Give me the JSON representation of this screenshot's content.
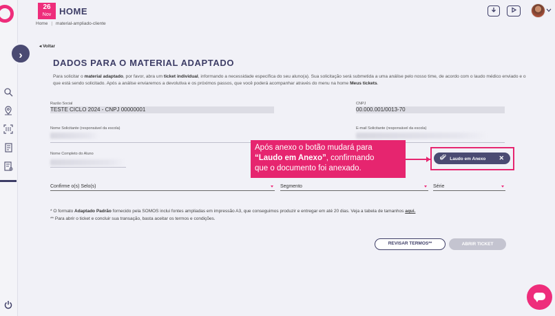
{
  "header": {
    "date_day": "26",
    "date_month": "Nov",
    "title": "HOME",
    "breadcrumb_home": "Home",
    "breadcrumb_sep": "|",
    "breadcrumb_current": "material-ampliado-cliente"
  },
  "nav": {
    "back": "Voltar"
  },
  "page": {
    "title": "DADOS PARA O MATERIAL ADAPTADO",
    "intro_part1": "Para solicitar o ",
    "intro_bold1": "material adaptado",
    "intro_part2": ", por favor, abra um ",
    "intro_bold2": "ticket individual",
    "intro_part3": ", informando a necessidade específica do seu aluno(a). Sua solicitação será submetida a uma análise pelo nosso time, de acordo com o laudo médico enviado e o que está sendo solicitado. Após a análise enviaremos a devolutiva e os próximos passos, que você poderá acompanhar através do menu na home ",
    "intro_bold3": "Meus tickets",
    "intro_end": "."
  },
  "form": {
    "razao_social_label": "Razão Social",
    "razao_social_value": "TESTE CICLO 2024 - CNPJ 00000001",
    "cnpj_label": "CNPJ",
    "cnpj_value": "00.000.001/0013-70",
    "solicitante_label": "Nome Solicitante (responsável da escola)",
    "email_label": "E-mail Solicitante (responsável da escola)",
    "aluno_label": "Nome Completo do Aluno",
    "selos_placeholder": "Confirme o(s) Selo(s)",
    "segmento_placeholder": "Segmento",
    "serie_placeholder": "Série"
  },
  "attachment": {
    "chip_label": "Laudo em Anexo"
  },
  "annotation": {
    "line1": "Após anexo o botão mudará para",
    "line2_bold": "“Laudo em Anexo”",
    "line2_rest": ", confirmando",
    "line3": "que o documento foi anexado."
  },
  "notes": {
    "note1_part1": "* O formato ",
    "note1_bold": "Adaptado Padrão",
    "note1_part2": " fornecido pela SOMOS inclui fontes ampliadas em impressão A3, que conseguimos produzir e entregar em até 20 dias. Veja a tabela de tamanhos ",
    "note1_link": "aqui.",
    "note2": "** Para abrir o ticket e concluir sua transação, basta aceitar os termos e condições."
  },
  "actions": {
    "revisar": "REVISAR TERMOS**",
    "abrir": "ABRIR TICKET"
  },
  "colors": {
    "accent": "#ee2d7b",
    "primary": "#3d3d66",
    "background": "#f1f1f7"
  }
}
